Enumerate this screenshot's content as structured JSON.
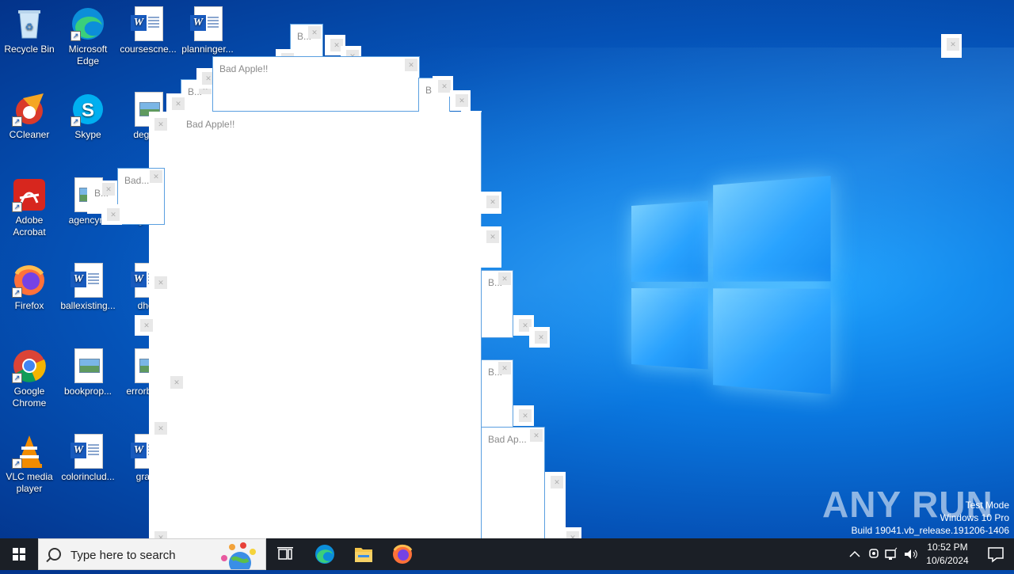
{
  "desktop_icons": [
    {
      "label": "Recycle Bin",
      "type": "recycle"
    },
    {
      "label": "Microsoft Edge",
      "type": "edge"
    },
    {
      "label": "coursescne...",
      "type": "word"
    },
    {
      "label": "planninger...",
      "type": "word"
    },
    {
      "label": "CCleaner",
      "type": "ccleaner"
    },
    {
      "label": "Skype",
      "type": "skype"
    },
    {
      "label": "degree",
      "type": "image"
    },
    {
      "label": "Adobe Acrobat",
      "type": "acrobat"
    },
    {
      "label": "agencym",
      "type": "image"
    },
    {
      "label": "degreewa",
      "type": "image"
    },
    {
      "label": "Firefox",
      "type": "firefox"
    },
    {
      "label": "ballexisting...",
      "type": "word"
    },
    {
      "label": "dhou",
      "type": "word"
    },
    {
      "label": "Google Chrome",
      "type": "chrome"
    },
    {
      "label": "bookprop...",
      "type": "image"
    },
    {
      "label": "errorbed.p",
      "type": "image"
    },
    {
      "label": "VLC media player",
      "type": "vlc"
    },
    {
      "label": "colorinclud...",
      "type": "word"
    },
    {
      "label": "grade",
      "type": "word"
    }
  ],
  "popup_windows": {
    "large_title": "Bad Apple!!",
    "top_title": "Bad Apple!!",
    "bad_label": "Bad...",
    "bad_ap_label": "Bad Ap...",
    "b_label": "B..."
  },
  "watermark": {
    "text": "ANY RUN"
  },
  "os_info": {
    "test_mode": "Test Mode",
    "edition": "Windows 10 Pro",
    "build": "Build 19041.vb_release.191206-1406"
  },
  "taskbar": {
    "search_placeholder": "Type here to search",
    "time": "10:52 PM",
    "date": "10/6/2024",
    "pinned": [
      "task-view",
      "edge",
      "file-explorer",
      "firefox"
    ]
  }
}
